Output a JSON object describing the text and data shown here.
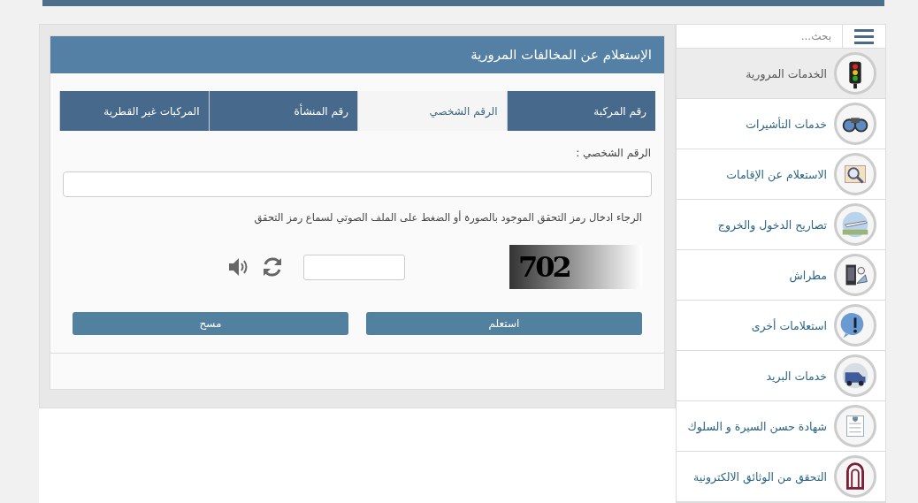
{
  "sidebar": {
    "search": {
      "placeholder": "بحث..."
    },
    "items": [
      {
        "label": "الخدمات المرورية",
        "selected": true
      },
      {
        "label": "خدمات التأشيرات",
        "selected": false
      },
      {
        "label": "الاستعلام عن الإقامات",
        "selected": false
      },
      {
        "label": "تصاريح الدخول والخروج",
        "selected": false
      },
      {
        "label": "مطراش",
        "selected": false
      },
      {
        "label": "استعلامات أخرى",
        "selected": false
      },
      {
        "label": "خدمات البريد",
        "selected": false
      },
      {
        "label": "شهادة حسن السيرة و السلوك",
        "selected": false
      },
      {
        "label": "التحقق من الوثائق الالكترونية",
        "selected": false
      }
    ]
  },
  "panel": {
    "title": "الإستعلام عن المخالفات المرورية",
    "tabs": [
      {
        "label": "رقم المركبة",
        "selected": false
      },
      {
        "label": "الرقم الشخصي",
        "selected": true
      },
      {
        "label": "رقم المنشأة",
        "selected": false
      },
      {
        "label": "المركبات غير القطرية",
        "selected": false
      }
    ],
    "field": {
      "label": "الرقم الشخصي :"
    },
    "captcha": {
      "hint": "الرجاء ادخال رمز التحقق الموجود بالصورة أو الضغط على الملف الصوتي لسماع رمز التحقق",
      "code": "702"
    },
    "buttons": [
      {
        "label": "استعلم"
      },
      {
        "label": "مسح"
      }
    ]
  }
}
